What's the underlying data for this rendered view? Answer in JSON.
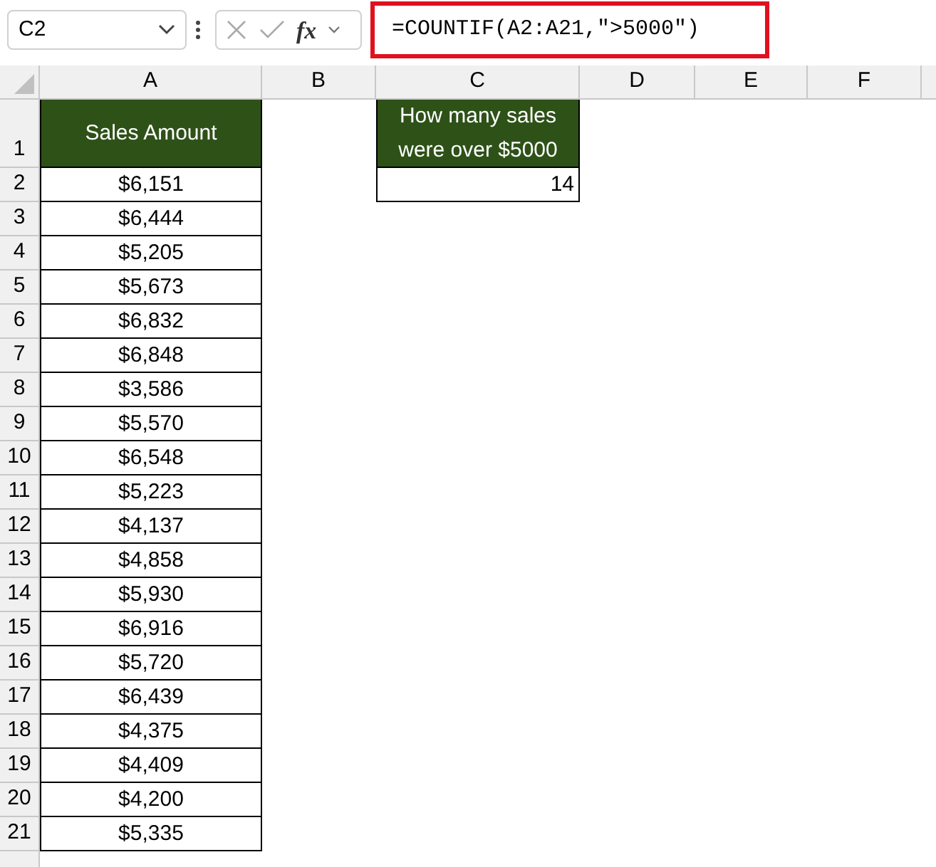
{
  "name_box": {
    "value": "C2"
  },
  "formula_bar": {
    "fx_label": "fx",
    "formula": "=COUNTIF(A2:A21,\">5000\")"
  },
  "columns": [
    "A",
    "B",
    "C",
    "D",
    "E",
    "F"
  ],
  "rows": [
    {
      "label": "1",
      "a": {
        "kind": "header",
        "text": "Sales Amount"
      },
      "c": {
        "kind": "header",
        "text": "How many sales were over $5000"
      }
    },
    {
      "label": "2",
      "a": {
        "kind": "money",
        "text": "$6,151"
      },
      "c": {
        "kind": "count",
        "text": "14"
      }
    },
    {
      "label": "3",
      "a": {
        "kind": "money",
        "text": "$6,444"
      }
    },
    {
      "label": "4",
      "a": {
        "kind": "money",
        "text": "$5,205"
      }
    },
    {
      "label": "5",
      "a": {
        "kind": "money",
        "text": "$5,673"
      }
    },
    {
      "label": "6",
      "a": {
        "kind": "money",
        "text": "$6,832"
      }
    },
    {
      "label": "7",
      "a": {
        "kind": "money",
        "text": "$6,848"
      }
    },
    {
      "label": "8",
      "a": {
        "kind": "money",
        "text": "$3,586"
      }
    },
    {
      "label": "9",
      "a": {
        "kind": "money",
        "text": "$5,570"
      }
    },
    {
      "label": "10",
      "a": {
        "kind": "money",
        "text": "$6,548"
      }
    },
    {
      "label": "11",
      "a": {
        "kind": "money",
        "text": "$5,223"
      }
    },
    {
      "label": "12",
      "a": {
        "kind": "money",
        "text": "$4,137"
      }
    },
    {
      "label": "13",
      "a": {
        "kind": "money",
        "text": "$4,858"
      }
    },
    {
      "label": "14",
      "a": {
        "kind": "money",
        "text": "$5,930"
      }
    },
    {
      "label": "15",
      "a": {
        "kind": "money",
        "text": "$6,916"
      }
    },
    {
      "label": "16",
      "a": {
        "kind": "money",
        "text": "$5,720"
      }
    },
    {
      "label": "17",
      "a": {
        "kind": "money",
        "text": "$6,439"
      }
    },
    {
      "label": "18",
      "a": {
        "kind": "money",
        "text": "$4,375"
      }
    },
    {
      "label": "19",
      "a": {
        "kind": "money",
        "text": "$4,409"
      }
    },
    {
      "label": "20",
      "a": {
        "kind": "money",
        "text": "$4,200"
      }
    },
    {
      "label": "21",
      "a": {
        "kind": "money",
        "text": "$5,335"
      }
    }
  ]
}
